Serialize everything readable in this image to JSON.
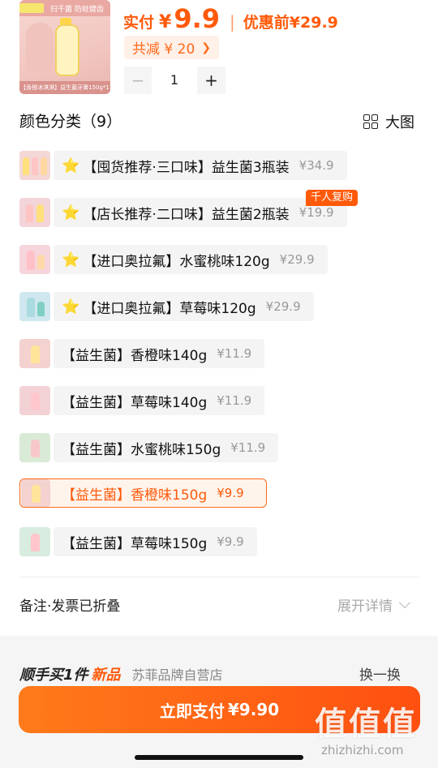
{
  "product": {
    "thumbnail_icon": "toothpaste-bottle-image",
    "thumbnail_caption": "【香橙冰淇淋】益生菌牙膏150g*1",
    "thumbnail_brand": "扫千菌 防蛀健齿",
    "price_label": "实付",
    "currency": "¥",
    "price": "9.9",
    "original_label": "优惠前",
    "original_price": "¥29.9",
    "discount_text": "共减 ¥ 20",
    "discount_icon": "chevron-right-icon",
    "quantity": "1",
    "minus": "−",
    "plus": "+"
  },
  "options": {
    "title": "颜色分类（9）",
    "big_view_label": "大图",
    "big_view_icon": "grid-view-icon",
    "variants": [
      {
        "star": "⭐",
        "name": "【囤货推荐·三口味】益生菌3瓶装",
        "price": "¥34.9"
      },
      {
        "star": "⭐",
        "name": "【店长推荐·二口味】益生菌2瓶装",
        "price": "¥19.9",
        "badge": "千人复购"
      },
      {
        "star": "⭐",
        "name": "【进口奥拉氟】水蜜桃味120g",
        "price": "¥29.9"
      },
      {
        "star": "⭐",
        "name": "【进口奥拉氟】草莓味120g",
        "price": "¥29.9"
      },
      {
        "name": "【益生菌】香橙味140g",
        "price": "¥11.9"
      },
      {
        "name": "【益生菌】草莓味140g",
        "price": "¥11.9"
      },
      {
        "name": "【益生菌】水蜜桃味150g",
        "price": "¥11.9"
      },
      {
        "name": "【益生菌】香橙味150g",
        "price": "¥9.9",
        "selected": true
      },
      {
        "name": "【益生菌】草莓味150g",
        "price": "¥9.9"
      }
    ]
  },
  "remark": {
    "label": "备注·发票已折叠",
    "expand_label": "展开详情",
    "expand_icon": "chevron-down-icon"
  },
  "peek": {
    "text1": "顺手买1件",
    "text2": "新品",
    "text3": "苏菲品牌自营店",
    "text4": "换一换"
  },
  "pay": {
    "label": "立即支付",
    "currency": "¥",
    "amount": "9.90"
  },
  "watermark": {
    "logo": "值值值",
    "domain": "zhizhizhi.com"
  },
  "colors": {
    "accent": "#ff5a0a",
    "selected_bg": "#fff4ec",
    "variant_bg": "#f4f4f4",
    "star": "#ffb400"
  }
}
